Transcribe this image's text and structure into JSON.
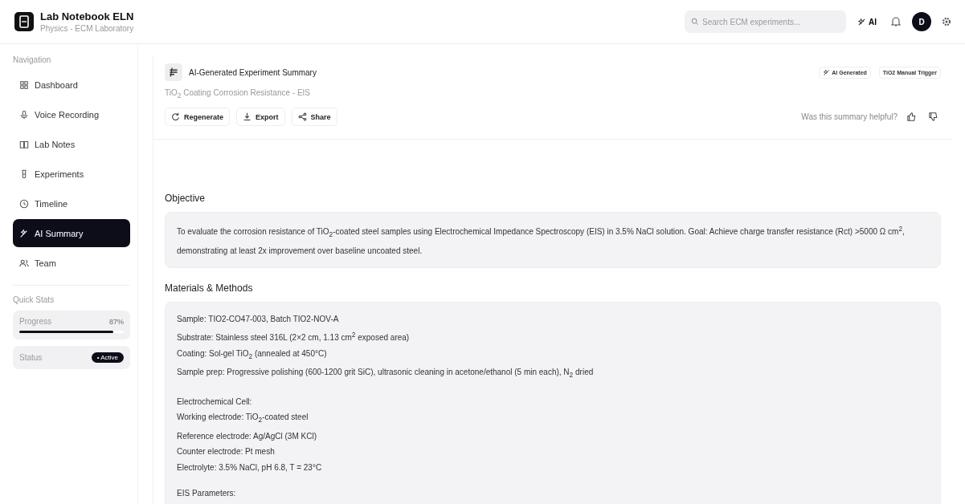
{
  "app": {
    "title": "Lab Notebook ELN",
    "subtitle": "Physics - ECM Laboratory"
  },
  "header": {
    "search": {
      "placeholder": "Search ECM experiments..."
    },
    "ai_button": "AI",
    "avatar": "D"
  },
  "sidebar": {
    "nav_heading": "Navigation",
    "items": [
      {
        "label": "Dashboard",
        "selected": false
      },
      {
        "label": "Voice Recording",
        "selected": false
      },
      {
        "label": "Lab Notes",
        "selected": false
      },
      {
        "label": "Experiments",
        "selected": false
      },
      {
        "label": "Timeline",
        "selected": false
      },
      {
        "label": "AI Summary",
        "selected": true
      },
      {
        "label": "Team",
        "selected": false
      }
    ],
    "stats_heading": "Quick Stats",
    "progress": {
      "label": "Progress",
      "value": "87%",
      "level": 0.9
    },
    "status": {
      "label": "Status",
      "value": "• Active"
    }
  },
  "summary": {
    "title": "AI-Generated Experiment Summary",
    "subtitle": "TiO$_{2}$ Coating Corrosion Resistance - EIS",
    "badges": [
      "AI Generated",
      "TiO2 Manual Trigger"
    ],
    "actions": [
      "Regenerate",
      "Export",
      "Share"
    ],
    "feedback": "Was this summary helpful?"
  },
  "sections": [
    {
      "heading": "Objective",
      "paragraphs": [
        [
          "To evaluate the corrosion resistance of TiO$_{2}$-coated steel samples using Electrochemical Impedance Spectroscopy (EIS) in 3.5% NaCl solution. Goal: Achieve charge transfer resistance (Rct) >5000 Ω cm$^{2}$, demonstrating at least 2x improvement over baseline uncoated steel."
        ]
      ]
    },
    {
      "heading": "Materials & Methods",
      "paragraphs": [
        [
          "Sample: TIO2-CO47-003, Batch TIO2-NOV-A",
          "Substrate: Stainless steel 316L (2×2 cm, 1.13 cm$^{2}$ exposed area)",
          "Coating: Sol-gel TiO$_{2}$ (annealed at 450°C)",
          "Sample prep: Progressive polishing (600-1200 grit SiC), ultrasonic cleaning in acetone/ethanol (5 min each), N$_{2}$ dried"
        ],
        [
          "Electrochemical Cell:",
          "Working electrode: TiO$_{2}$-coated steel",
          "Reference electrode: Ag/AgCl (3M KCl)",
          "Counter electrode: Pt mesh",
          "Electrolyte: 3.5% NaCl, pH 6.8, T = 23°C"
        ],
        [
          "EIS Parameters:"
        ]
      ]
    }
  ]
}
